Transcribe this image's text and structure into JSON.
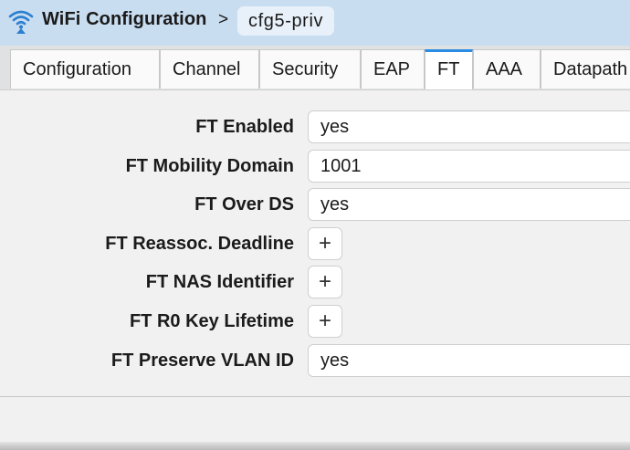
{
  "header": {
    "title": "WiFi Configuration",
    "separator": ">",
    "breadcrumb": "cfg5-priv",
    "icon": "wifi-icon"
  },
  "tabs": [
    {
      "label": "Configuration",
      "active": false
    },
    {
      "label": "Channel",
      "active": false
    },
    {
      "label": "Security",
      "active": false
    },
    {
      "label": "EAP",
      "active": false
    },
    {
      "label": "FT",
      "active": true
    },
    {
      "label": "AAA",
      "active": false
    },
    {
      "label": "Datapath",
      "active": false
    }
  ],
  "fields": {
    "ft_enabled": {
      "label": "FT Enabled",
      "value": "yes"
    },
    "ft_mobility_domain": {
      "label": "FT Mobility Domain",
      "value": "1001"
    },
    "ft_over_ds": {
      "label": "FT Over DS",
      "value": "yes"
    },
    "ft_reassoc_deadline": {
      "label": "FT Reassoc. Deadline",
      "add": "+"
    },
    "ft_nas_identifier": {
      "label": "FT NAS Identifier",
      "add": "+"
    },
    "ft_r0_key_lifetime": {
      "label": "FT R0 Key Lifetime",
      "add": "+"
    },
    "ft_preserve_vlan_id": {
      "label": "FT Preserve VLAN ID",
      "value": "yes"
    }
  },
  "colors": {
    "header_bg": "#c9ddf0",
    "active_tab_accent": "#2b8ce3"
  }
}
